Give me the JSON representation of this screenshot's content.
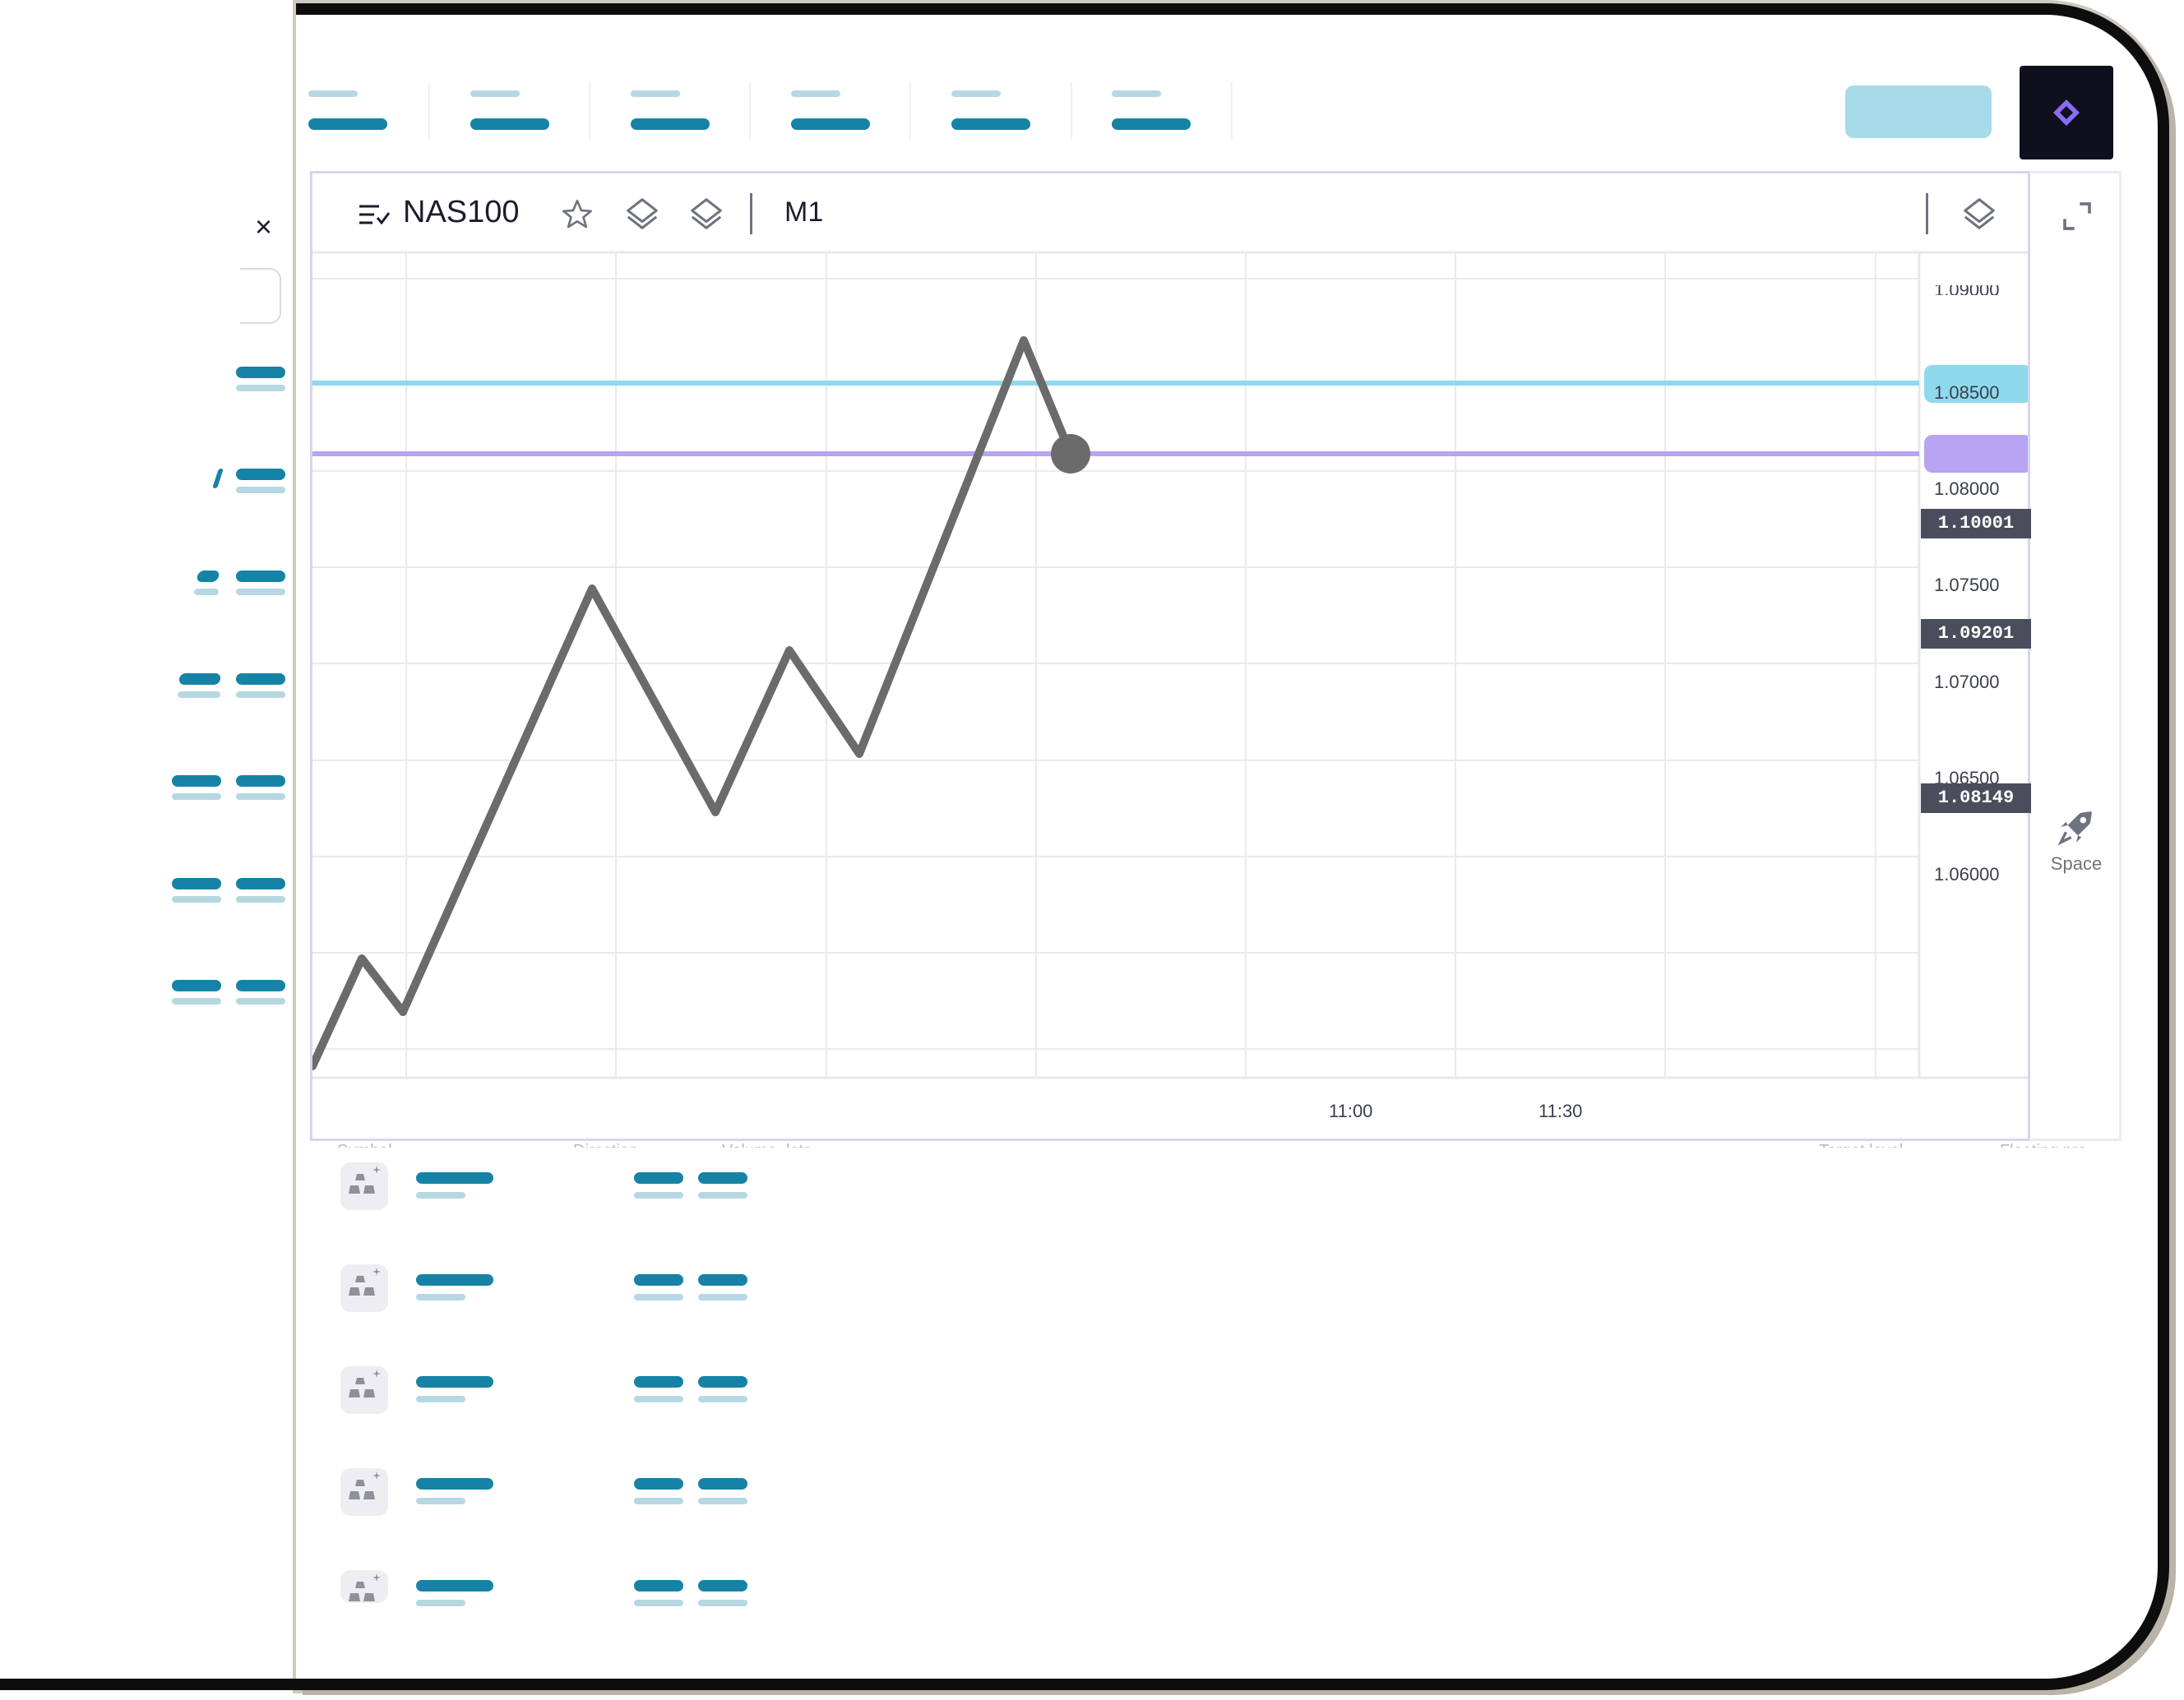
{
  "symbol": "NAS100",
  "timeframe": "M1",
  "rail": {
    "space_label": "Space"
  },
  "close_label": "×",
  "table_headers": [
    "Symbol",
    "Direction",
    "Volume, lots",
    "Target level",
    "Floating pro"
  ],
  "price_axis": {
    "ticks": [
      "1.09000",
      "1.08500",
      "1.08000",
      "1.07500",
      "1.07000",
      "1.06500",
      "1.06000"
    ],
    "badges": [
      "1.10001",
      "1.09201",
      "1.08149"
    ]
  },
  "time_axis": {
    "ticks": [
      "11:00",
      "11:30"
    ]
  },
  "colors": {
    "accent_dark": "#1683a6",
    "accent_light": "#b6d8e2",
    "cyan_line": "#8ed9ec",
    "purple_line": "#b9a3f3",
    "price_line": "#6b6b6b",
    "badge_bg": "#4a4e5c"
  },
  "icons": [
    "list-check-icon",
    "star-icon",
    "layers-icon",
    "expand-icon",
    "rocket-icon",
    "gold-bars-icon",
    "logo-icon",
    "close-icon"
  ]
}
